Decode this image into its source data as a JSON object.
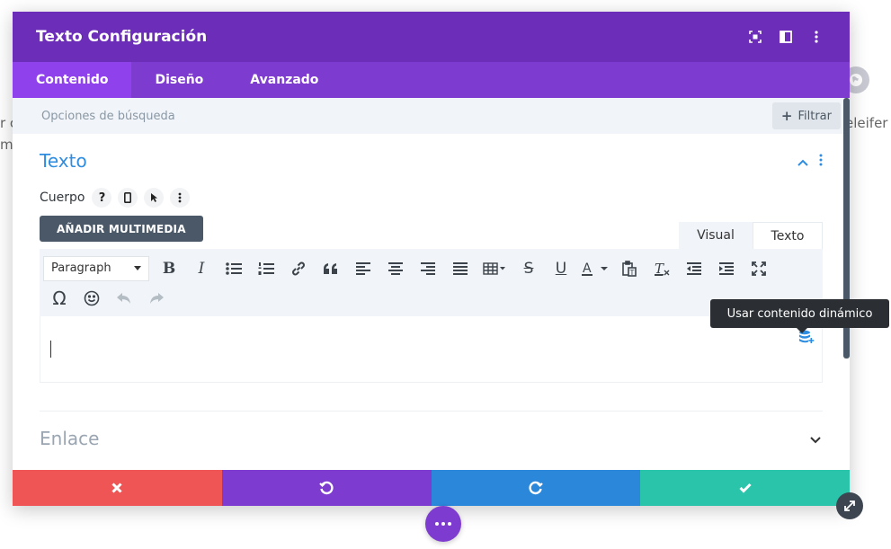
{
  "background": {
    "left_fragment_1": "r c",
    "left_fragment_2": "m",
    "right_fragment": "eleifer"
  },
  "panel": {
    "title": "Texto Configuración",
    "tabs": [
      {
        "label": "Contenido",
        "active": true
      },
      {
        "label": "Diseño",
        "active": false
      },
      {
        "label": "Avanzado",
        "active": false
      }
    ],
    "search": {
      "placeholder": "Opciones de búsqueda",
      "filter_label": "Filtrar"
    },
    "section_texto": {
      "title": "Texto",
      "field_label": "Cuerpo",
      "add_media_label": "AÑADIR MULTIMEDIA",
      "editor_tabs": {
        "visual": "Visual",
        "text": "Texto"
      },
      "format_select": "Paragraph",
      "dynamic_tooltip": "Usar contenido dinámico"
    },
    "section_enlace": {
      "title": "Enlace"
    }
  },
  "colors": {
    "header": "#6c2eb9",
    "tabs_bar": "#7e3bd0",
    "active_tab": "#8f42ec",
    "accent_blue": "#2e8de0",
    "cancel": "#ef5555",
    "undo": "#7e3bd0",
    "redo": "#2b87da",
    "save": "#29c4a9"
  }
}
